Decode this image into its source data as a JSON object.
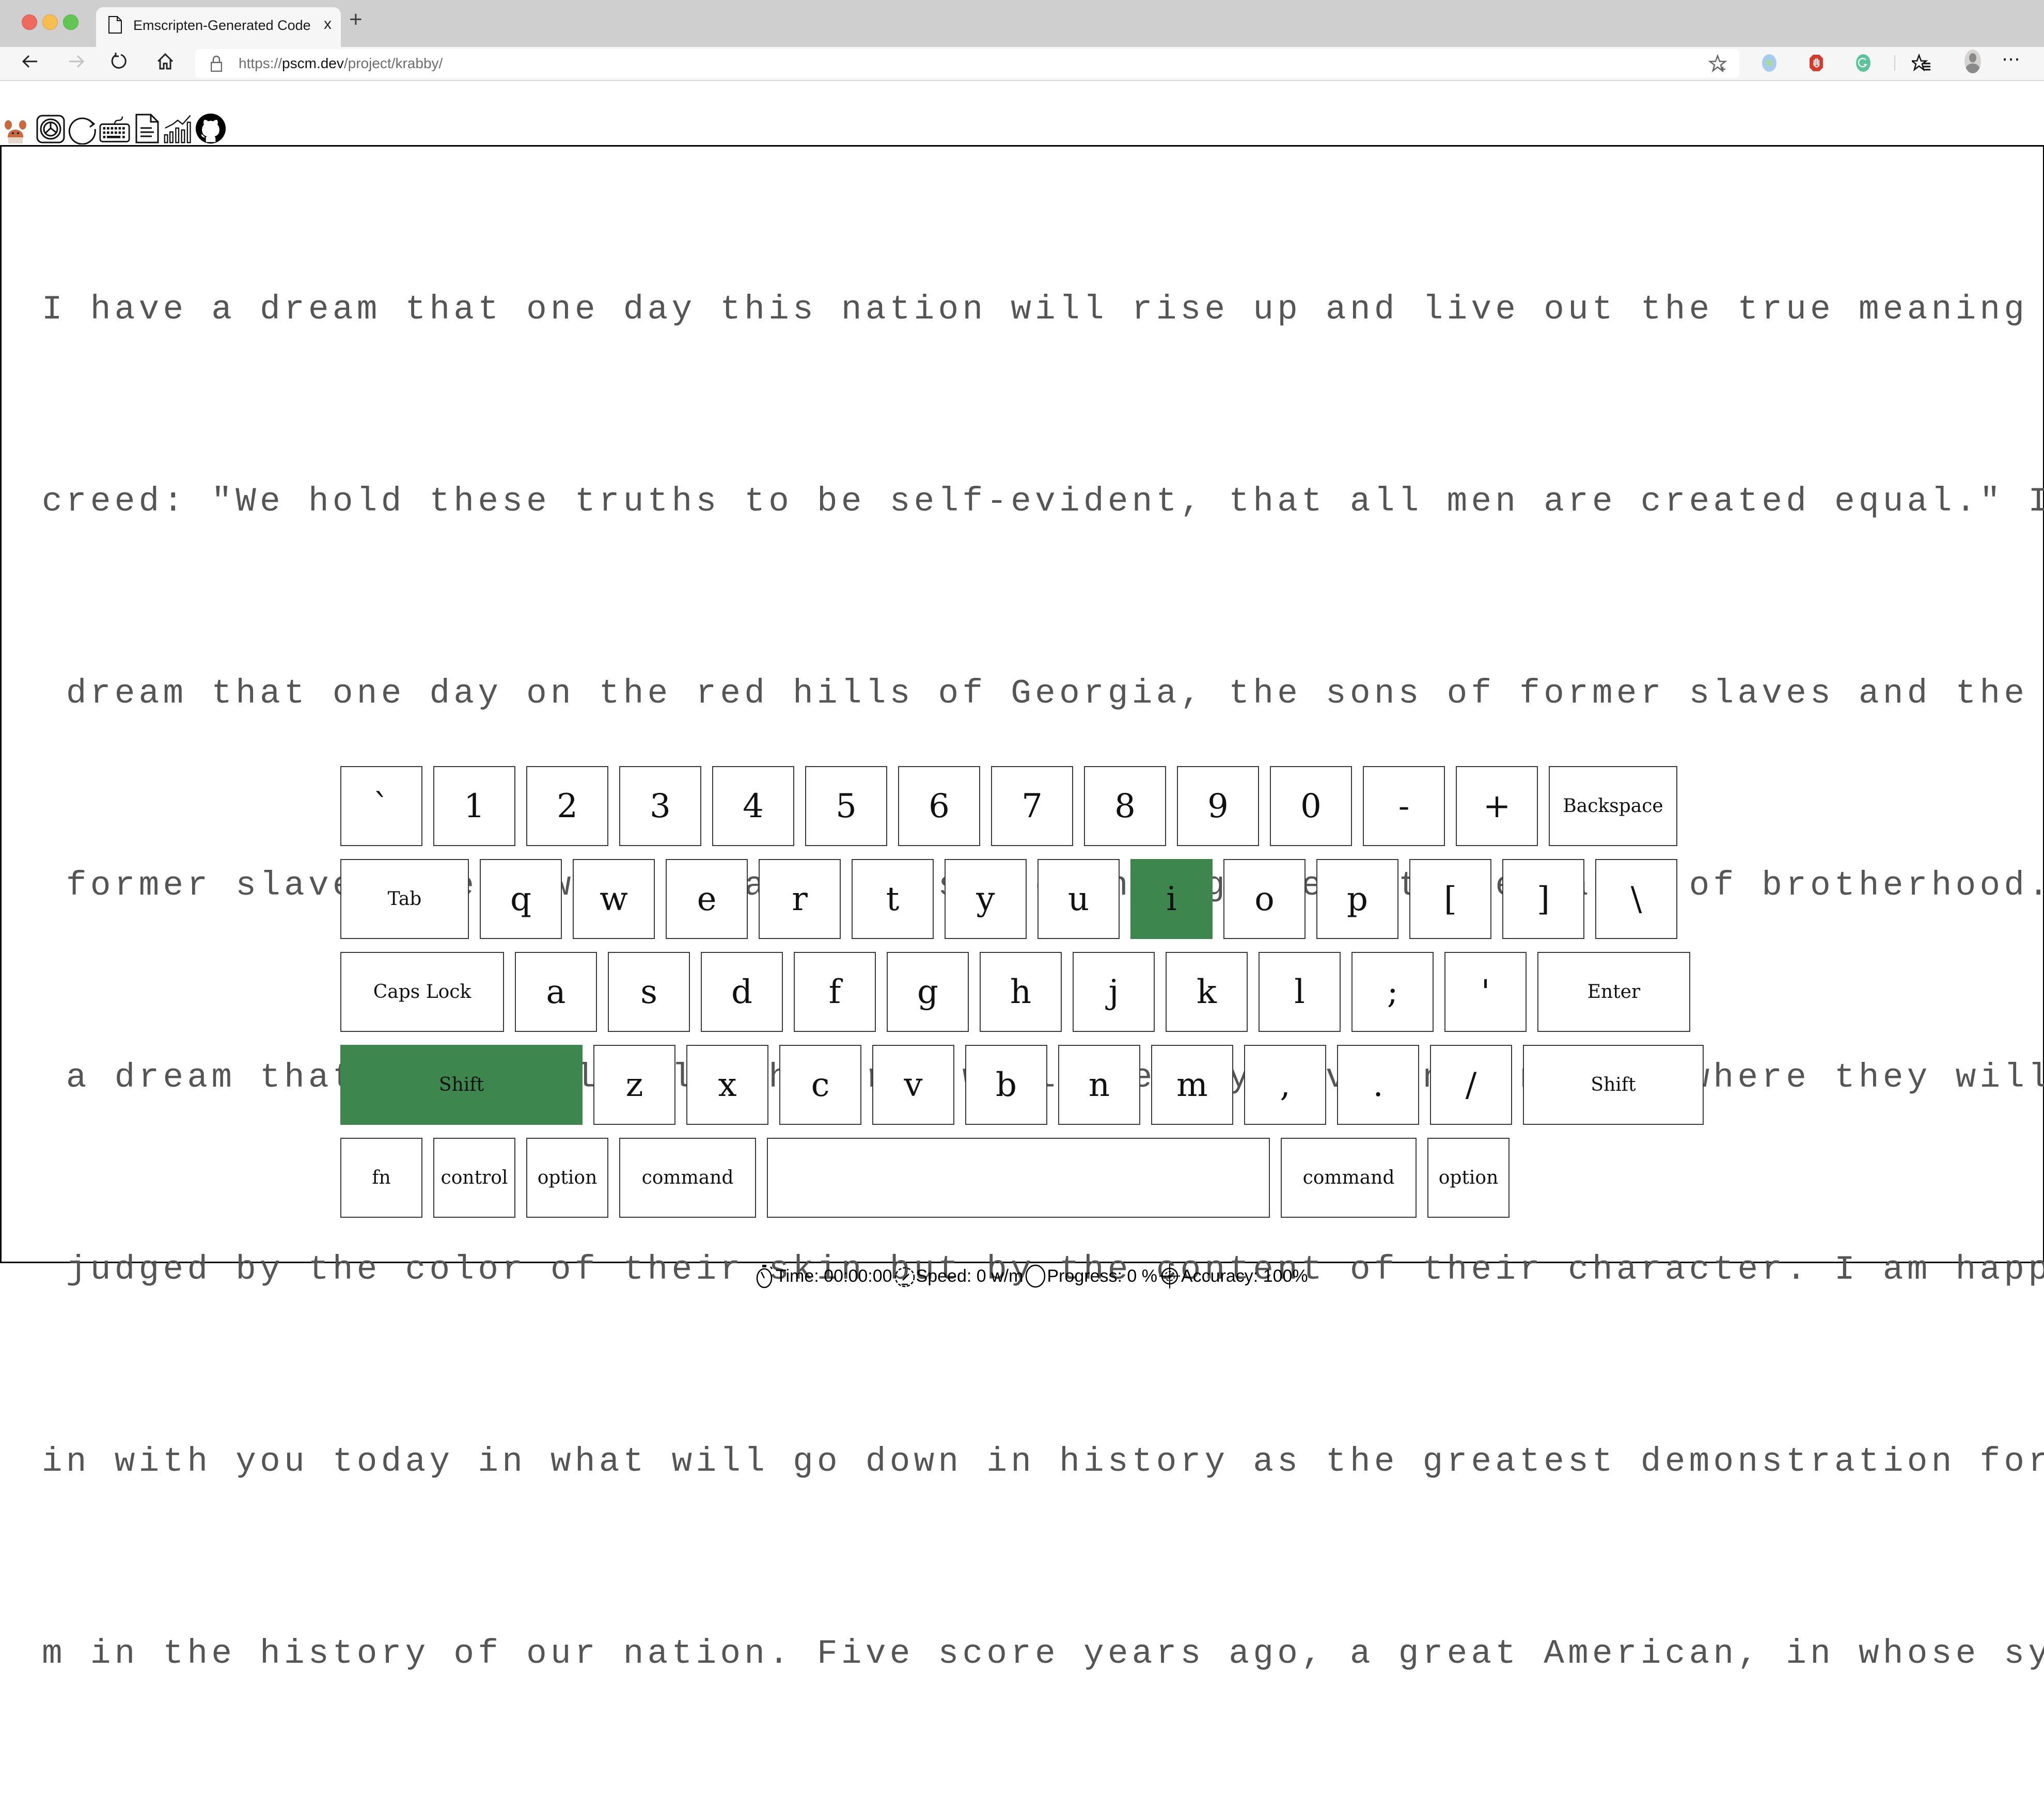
{
  "browser": {
    "tab_title": "Emscripten-Generated Code",
    "tab_close": "x",
    "new_tab": "+",
    "url_scheme": "https://",
    "url_domain": "pscm.dev",
    "url_path": "/project/krabby/",
    "more_menu": "⋯"
  },
  "toolbar": {
    "icons": [
      "crab-logo-icon",
      "theme-icon",
      "restart-icon",
      "keyboard-icon",
      "text-document-icon",
      "stats-chart-icon",
      "github-icon"
    ]
  },
  "passage": {
    "lines": [
      "I have a dream that one day this nation will rise up and live out the true meaning of its",
      "creed: \"We hold these truths to be self-evident, that all men are created equal.\" I have a",
      " dream that one day on the red hills of Georgia, the sons of former slaves and the sons of",
      " former slave owners will be able to sit down together at the table of brotherhood. I have",
      " a dream that my four little children will one day live in a nation where they will not be",
      " judged by the color of their skin but by the content of their character. I am happy to jo",
      "in with you today in what will go down in history as the greatest demonstration for freedo",
      "m in the history of our nation. Five score years ago, a great American, in whose symbolic"
    ]
  },
  "keyboard": {
    "highlight_color": "#3d864e",
    "rows": [
      [
        {
          "label": "`",
          "w": 1
        },
        {
          "label": "1",
          "w": 1
        },
        {
          "label": "2",
          "w": 1
        },
        {
          "label": "3",
          "w": 1
        },
        {
          "label": "4",
          "w": 1
        },
        {
          "label": "5",
          "w": 1
        },
        {
          "label": "6",
          "w": 1
        },
        {
          "label": "7",
          "w": 1
        },
        {
          "label": "8",
          "w": 1
        },
        {
          "label": "9",
          "w": 1
        },
        {
          "label": "0",
          "w": 1
        },
        {
          "label": "-",
          "w": 1
        },
        {
          "label": "+",
          "w": 1
        },
        {
          "label": "Backspace",
          "w": 1.5
        }
      ],
      [
        {
          "label": "Tab",
          "w": 1.5
        },
        {
          "label": "q",
          "w": 1
        },
        {
          "label": "w",
          "w": 1
        },
        {
          "label": "e",
          "w": 1
        },
        {
          "label": "r",
          "w": 1
        },
        {
          "label": "t",
          "w": 1
        },
        {
          "label": "y",
          "w": 1
        },
        {
          "label": "u",
          "w": 1
        },
        {
          "label": "i",
          "w": 1,
          "active": true
        },
        {
          "label": "o",
          "w": 1
        },
        {
          "label": "p",
          "w": 1
        },
        {
          "label": "[",
          "w": 1
        },
        {
          "label": "]",
          "w": 1
        },
        {
          "label": "\\",
          "w": 1
        }
      ],
      [
        {
          "label": "Caps Lock",
          "w": 1.88
        },
        {
          "label": "a",
          "w": 1
        },
        {
          "label": "s",
          "w": 1
        },
        {
          "label": "d",
          "w": 1
        },
        {
          "label": "f",
          "w": 1
        },
        {
          "label": "g",
          "w": 1
        },
        {
          "label": "h",
          "w": 1
        },
        {
          "label": "j",
          "w": 1
        },
        {
          "label": "k",
          "w": 1
        },
        {
          "label": "l",
          "w": 1
        },
        {
          "label": ";",
          "w": 1
        },
        {
          "label": "'",
          "w": 1
        },
        {
          "label": "Enter",
          "w": 1.76
        }
      ],
      [
        {
          "label": "Shift",
          "w": 2.72,
          "active": true
        },
        {
          "label": "z",
          "w": 1
        },
        {
          "label": "x",
          "w": 1
        },
        {
          "label": "c",
          "w": 1
        },
        {
          "label": "v",
          "w": 1
        },
        {
          "label": "b",
          "w": 1
        },
        {
          "label": "n",
          "w": 1
        },
        {
          "label": "m",
          "w": 1
        },
        {
          "label": ",",
          "w": 1
        },
        {
          "label": ".",
          "w": 1
        },
        {
          "label": "/",
          "w": 1
        },
        {
          "label": "Shift",
          "w": 2.06
        }
      ],
      [
        {
          "label": "fn",
          "w": 1
        },
        {
          "label": "control",
          "w": 1
        },
        {
          "label": "option",
          "w": 1
        },
        {
          "label": "command",
          "w": 1.59
        },
        {
          "label": "",
          "w": 5.53
        },
        {
          "label": "command",
          "w": 1.58
        },
        {
          "label": "option",
          "w": 1
        }
      ]
    ]
  },
  "status": {
    "time": "Time: 00:00:00",
    "speed": "Speed: 0 w/m",
    "progress": "Progress: 0 %",
    "accuracy": "Accuracy: 100%",
    "progress_value": 0
  }
}
